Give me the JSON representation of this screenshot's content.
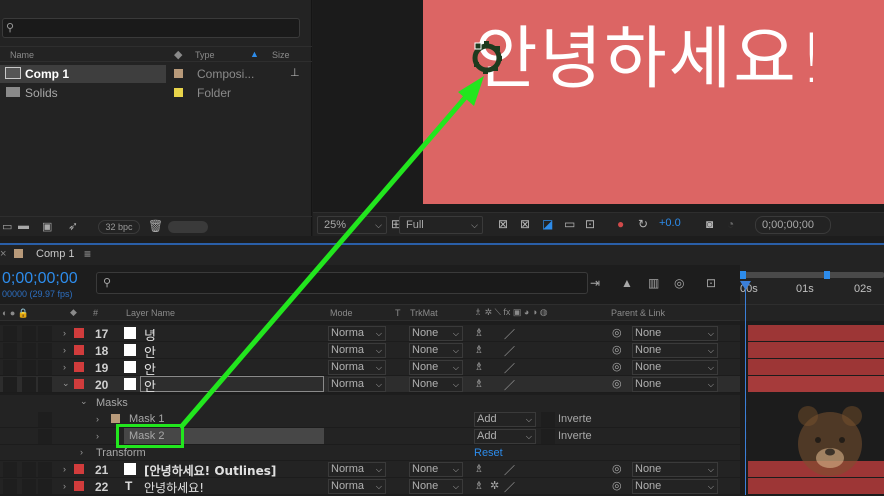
{
  "project": {
    "columns": {
      "name": "Name",
      "type": "Type",
      "size": "Size"
    },
    "items": [
      {
        "name": "Comp 1",
        "type": "Composi...",
        "color": "#b89a7a"
      },
      {
        "name": "Solids",
        "type": "Folder",
        "color": "#e8d44a"
      }
    ],
    "bpc": "32 bpc"
  },
  "viewer": {
    "text": "안녕하세요!",
    "bg_color": "#dc6564",
    "zoom": "25%",
    "resolution": "Full",
    "exposure": "+0.0",
    "timecode": "0;00;00;00"
  },
  "timeline": {
    "tab": "Comp 1",
    "timecode": "0;00;00;00",
    "fps": "00000 (29.97 fps)",
    "columns": {
      "layer_name": "Layer Name",
      "mode": "Mode",
      "t": "T",
      "trkmat": "TrkMat",
      "parent": "Parent & Link"
    },
    "ruler": [
      "00s",
      "01s",
      "02s"
    ],
    "layers": [
      {
        "num": "17",
        "name": "녕",
        "mode": "Norma",
        "trkmat": "None",
        "parent": "None"
      },
      {
        "num": "18",
        "name": "안",
        "mode": "Norma",
        "trkmat": "None",
        "parent": "None"
      },
      {
        "num": "19",
        "name": "안",
        "mode": "Norma",
        "trkmat": "None",
        "parent": "None"
      },
      {
        "num": "20",
        "name": "안",
        "mode": "Norma",
        "trkmat": "None",
        "parent": "None"
      }
    ],
    "masks_label": "Masks",
    "masks": [
      {
        "name": "Mask 1",
        "mode": "Add",
        "inverted": "Inverte"
      },
      {
        "name": "Mask 2",
        "mode": "Add",
        "inverted": "Inverte"
      }
    ],
    "transform_label": "Transform",
    "reset_label": "Reset",
    "layers_after": [
      {
        "num": "21",
        "name": "[안녕하세요! Outlines]",
        "mode": "Norma",
        "trkmat": "None",
        "parent": "None"
      },
      {
        "num": "22",
        "name": "안녕하세요!",
        "mode": "Norma",
        "trkmat": "None",
        "parent": "None",
        "type_icon": "T"
      }
    ]
  },
  "annotation": {
    "color": "#22e61e"
  }
}
